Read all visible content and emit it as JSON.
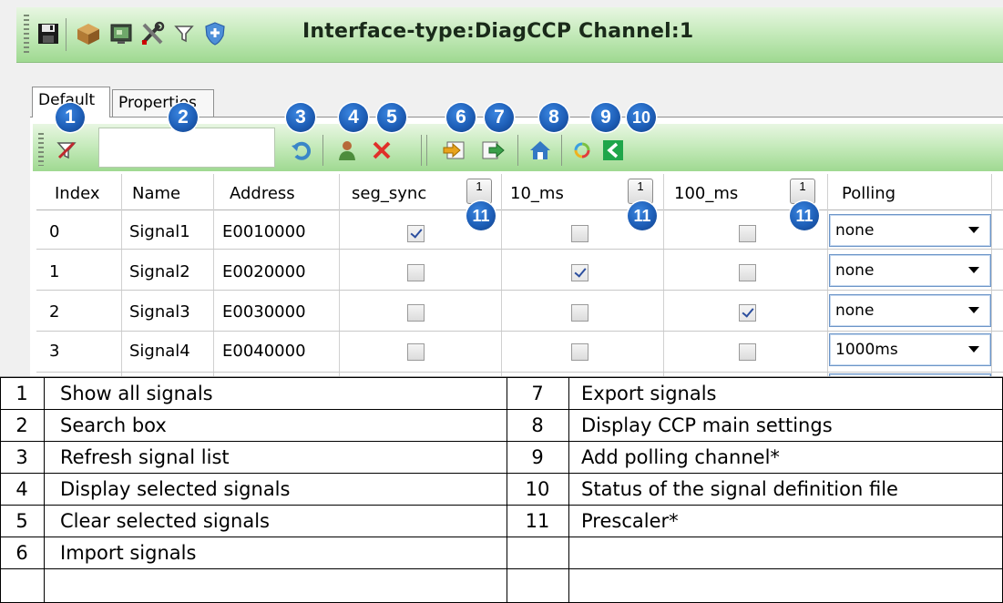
{
  "window": {
    "title": "Interface-type:DiagCCP Channel:1"
  },
  "toolbar_icons": [
    "save-icon",
    "package-icon",
    "monitor-icon",
    "tools-icon",
    "filter-icon",
    "shield-icon"
  ],
  "tabs": [
    {
      "label": "Default",
      "active": true
    },
    {
      "label": "Properties",
      "active": false
    }
  ],
  "search": {
    "value": ""
  },
  "toolbar2_icons": [
    "show-all-signals-icon",
    "refresh-icon",
    "display-selected-icon",
    "clear-selected-icon",
    "import-icon",
    "export-icon",
    "home-icon",
    "add-polling-icon",
    "status-icon"
  ],
  "badges": [
    "1",
    "2",
    "3",
    "4",
    "5",
    "6",
    "7",
    "8",
    "9",
    "10",
    "11",
    "11",
    "11"
  ],
  "table": {
    "headers": [
      "Index",
      "Name",
      "Address",
      "seg_sync",
      "10_ms",
      "100_ms",
      "Polling"
    ],
    "prescaler_value": "1",
    "rows": [
      {
        "index": "0",
        "name": "Signal1",
        "address": "E0010000",
        "seg_sync": true,
        "ms10": false,
        "ms100": false,
        "polling": "none"
      },
      {
        "index": "1",
        "name": "Signal2",
        "address": "E0020000",
        "seg_sync": false,
        "ms10": true,
        "ms100": false,
        "polling": "none"
      },
      {
        "index": "2",
        "name": "Signal3",
        "address": "E0030000",
        "seg_sync": false,
        "ms10": false,
        "ms100": true,
        "polling": "none"
      },
      {
        "index": "3",
        "name": "Signal4",
        "address": "E0040000",
        "seg_sync": false,
        "ms10": false,
        "ms100": false,
        "polling": "1000ms"
      }
    ]
  },
  "legend": [
    {
      "num": "1",
      "text": "Show all signals",
      "num2": "7",
      "text2": "Export signals"
    },
    {
      "num": "2",
      "text": "Search box",
      "num2": "8",
      "text2": "Display CCP main settings"
    },
    {
      "num": "3",
      "text": "Refresh signal list",
      "num2": "9",
      "text2": "Add polling channel*"
    },
    {
      "num": "4",
      "text": "Display selected signals",
      "num2": "10",
      "text2": "Status of the signal definition file"
    },
    {
      "num": "5",
      "text": "Clear selected signals",
      "num2": "11",
      "text2": "Prescaler*"
    },
    {
      "num": "6",
      "text": "Import signals",
      "num2": "",
      "text2": ""
    }
  ]
}
